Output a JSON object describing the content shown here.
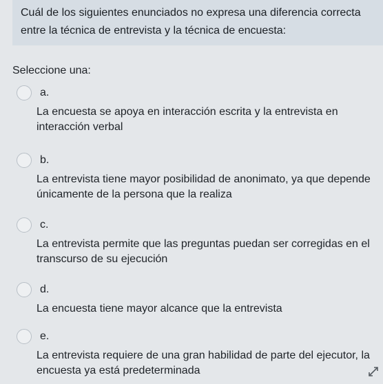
{
  "question": {
    "text": "Cuál de los siguientes enunciados no expresa una diferencia correcta entre la técnica de entrevista y la técnica de encuesta:"
  },
  "prompt": "Seleccione una:",
  "options": [
    {
      "letter": "a.",
      "text": "La encuesta se apoya en interacción escrita y la entrevista en interacción verbal"
    },
    {
      "letter": "b.",
      "text": "La entrevista tiene mayor posibilidad de anonimato, ya que depende únicamente de la persona que la realiza"
    },
    {
      "letter": "c.",
      "text": "La entrevista permite que las preguntas puedan ser corregidas en el transcurso de su ejecución"
    },
    {
      "letter": "d.",
      "text": "La encuesta tiene mayor alcance que la entrevista"
    },
    {
      "letter": "e.",
      "text": "La entrevista requiere de una gran habilidad de parte del ejecutor, la encuesta ya está predeterminada"
    }
  ],
  "icons": {
    "resize": "resize-handle-icon"
  },
  "colors": {
    "question_background": "#d6dde4",
    "page_background": "#e4e7ea",
    "text": "#1f2328"
  }
}
